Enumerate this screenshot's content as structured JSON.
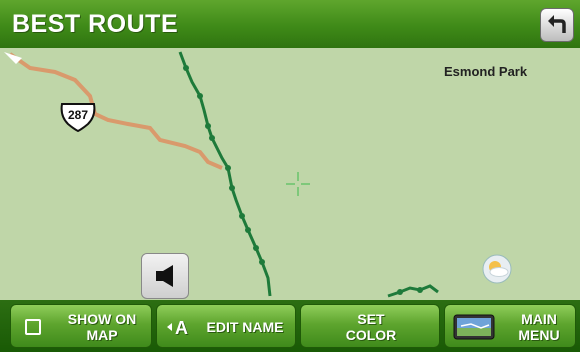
{
  "header": {
    "title": "BEST ROUTE"
  },
  "map": {
    "place_label": "Esmond Park",
    "highway_number": "287"
  },
  "toolbar": {
    "show_on_map_line1": "SHOW ON",
    "show_on_map_line2": "MAP",
    "edit_name_label": "EDIT NAME",
    "set_color_line1": "SET",
    "set_color_line2": "COLOR",
    "main_menu_line1": "MAIN",
    "main_menu_line2": "MENU"
  },
  "icons": {
    "back": "back-arrow-icon",
    "speaker": "speaker-icon",
    "weather": "weather-icon",
    "crosshair": "crosshair-icon",
    "edit": "edit-name-icon",
    "main_menu": "map-device-icon"
  },
  "colors": {
    "header_green": "#3f8a18",
    "map_background": "#bfd6a8",
    "route_green": "#1e7a3a",
    "highway_orange": "#d99a6c"
  }
}
